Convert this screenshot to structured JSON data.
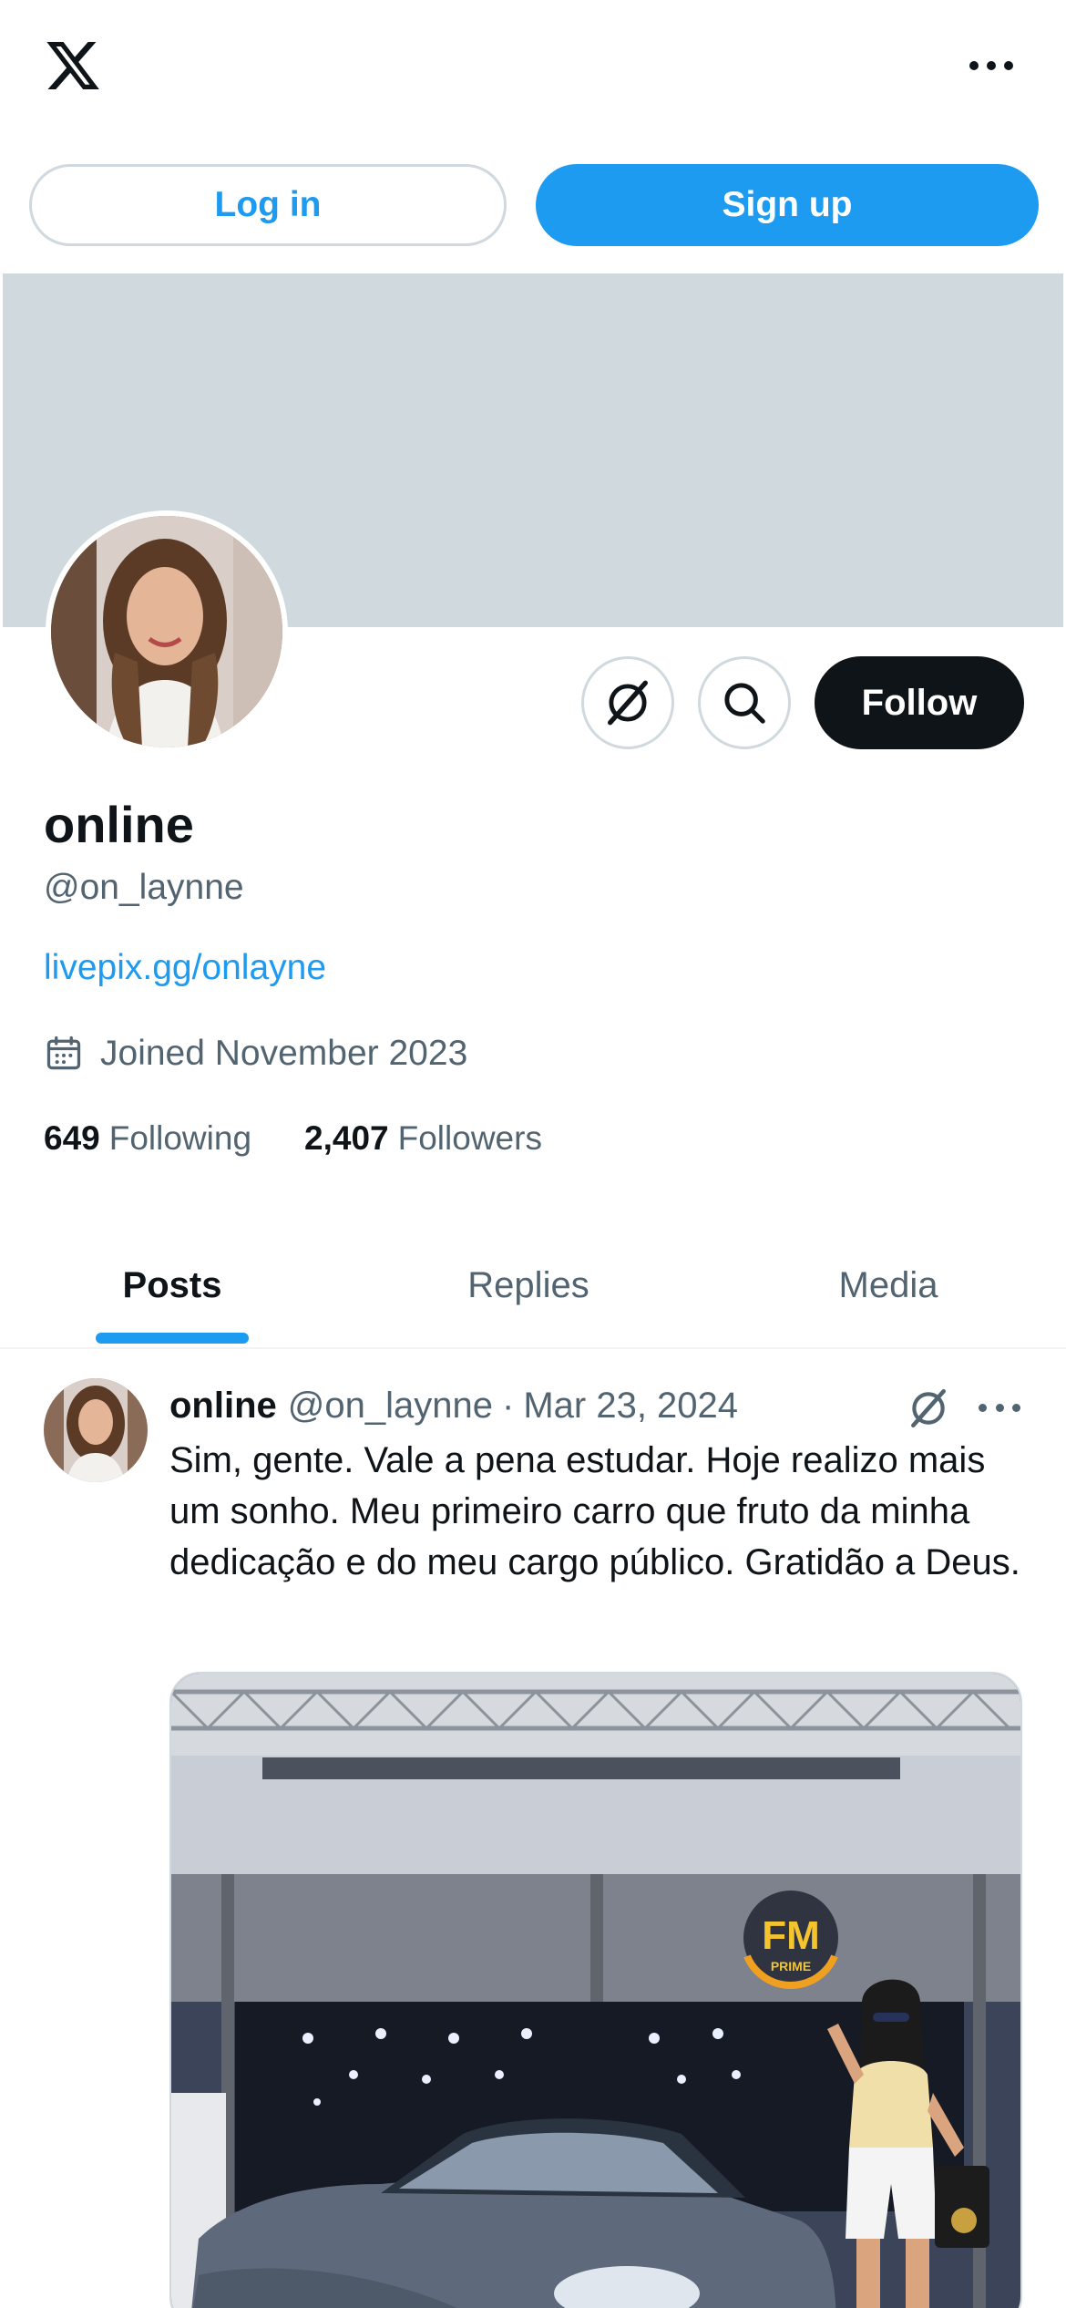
{
  "topbar": {
    "logo_icon": "x-logo-icon",
    "more_icon": "more-dots-icon"
  },
  "auth": {
    "login_label": "Log in",
    "signup_label": "Sign up"
  },
  "profile": {
    "display_name": "online",
    "handle": "@on_laynne",
    "link": "livepix.gg/onlayne",
    "joined": "Joined November 2023",
    "following_count": "649",
    "following_label": "Following",
    "followers_count": "2,407",
    "followers_label": "Followers",
    "follow_label": "Follow",
    "grok_icon": "grok-icon",
    "search_icon": "search-icon"
  },
  "tabs": [
    {
      "label": "Posts",
      "active": true
    },
    {
      "label": "Replies",
      "active": false
    },
    {
      "label": "Media",
      "active": false
    }
  ],
  "post": {
    "name": "online",
    "handle": "@on_laynne",
    "separator": "·",
    "date": "Mar 23, 2024",
    "text": "Sim, gente. Vale a pena estudar. Hoje realizo mais um sonho. Meu primeiro carro que fruto da minha dedicação e do meu cargo público. Gratidão a Deus.",
    "media_sign": "FM",
    "media_sign_sub": "PRIME"
  },
  "colors": {
    "accent": "#1d9bf0",
    "text": "#0f1419",
    "muted": "#536471",
    "banner": "#cfd9de"
  }
}
